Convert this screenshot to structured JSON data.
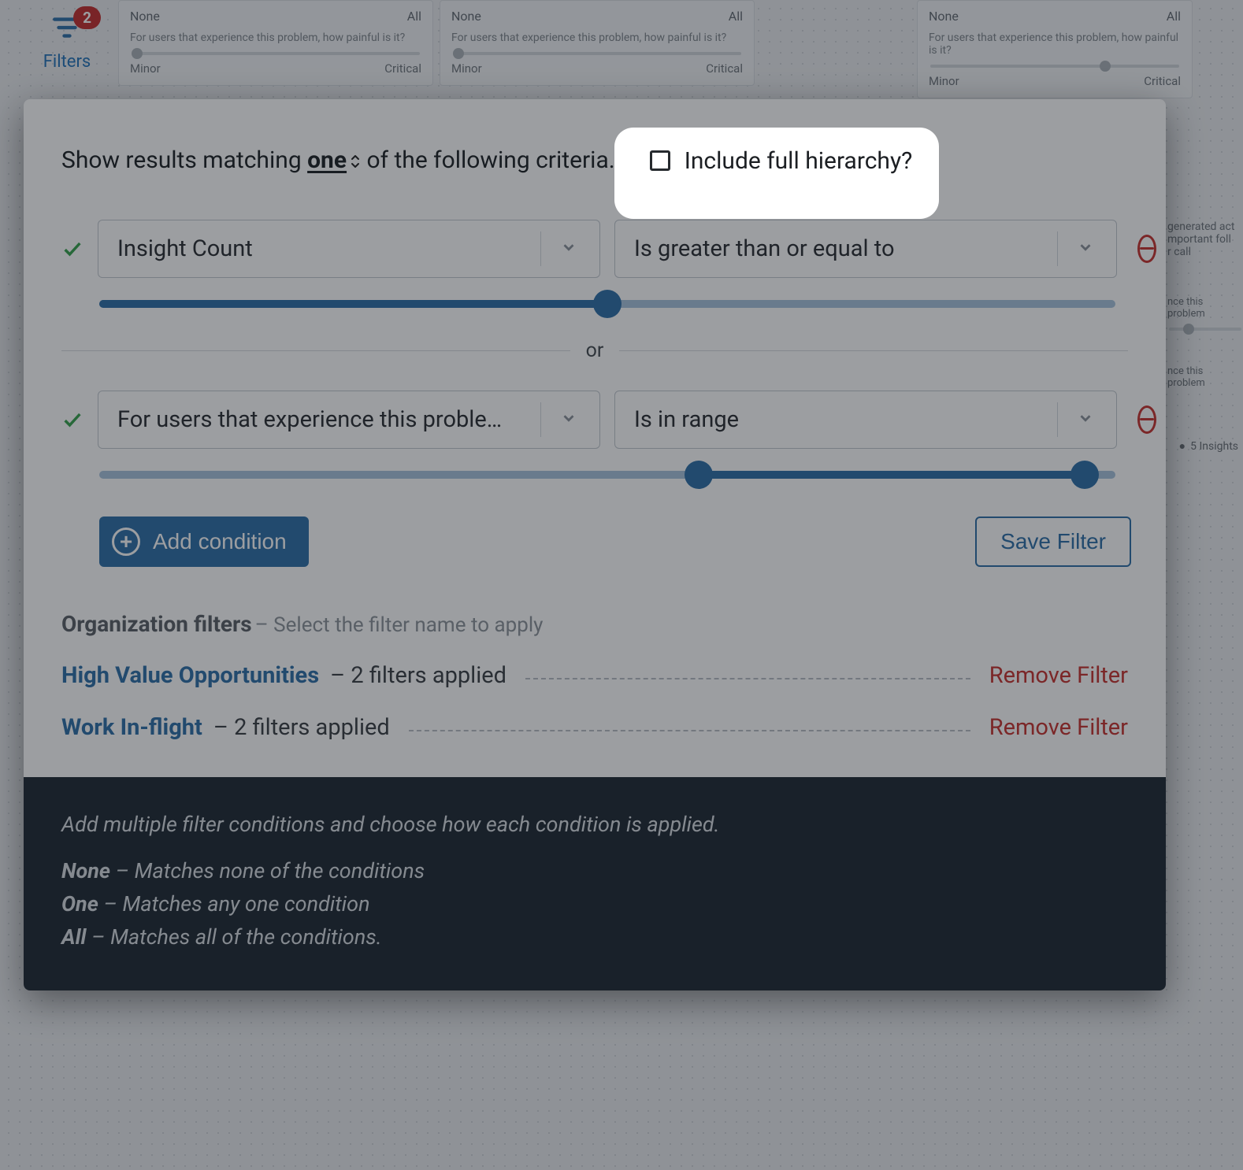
{
  "filters_button": {
    "label": "Filters",
    "badge": "2"
  },
  "bg_cards": {
    "question": "For users that experience this problem, how painful is it?",
    "top_left": "None",
    "top_right": "All",
    "bottom_left": "Minor",
    "bottom_right": "Critical"
  },
  "right_strip": {
    "line1": "generated act",
    "line2": "mportant foll",
    "line3": "r call",
    "q_frag": "nce this problem",
    "insights": "5 Insights"
  },
  "modal": {
    "show_results_prefix": "Show results matching ",
    "match_mode": "one",
    "show_results_suffix": " of the following criteria.",
    "include_label": "Include full hierarchy?",
    "conditions": [
      {
        "field": "Insight Count",
        "operator": "Is greater than or equal to",
        "slider": {
          "type": "single",
          "value_pct": 50
        }
      },
      {
        "field": "For users that experience this problem…",
        "operator": "Is in range",
        "slider": {
          "type": "range",
          "low_pct": 59,
          "high_pct": 97
        }
      }
    ],
    "separator": "or",
    "add_condition_label": "Add condition",
    "save_filter_label": "Save Filter",
    "org_filters": {
      "heading": "Organization filters",
      "subtitle": " – Select the filter name to apply",
      "rows": [
        {
          "name": "High Value Opportunities",
          "count": " – 2 filters applied",
          "remove": "Remove Filter"
        },
        {
          "name": "Work In-flight",
          "count": " – 2 filters applied",
          "remove": "Remove Filter"
        }
      ]
    },
    "help": {
      "intro": "Add multiple filter conditions and choose how each condition is applied.",
      "none_kw": "None",
      "none_desc": " – Matches none of the conditions",
      "one_kw": "One",
      "one_desc": " – Matches any one condition",
      "all_kw": "All",
      "all_desc": " – Matches all of the conditions."
    }
  }
}
